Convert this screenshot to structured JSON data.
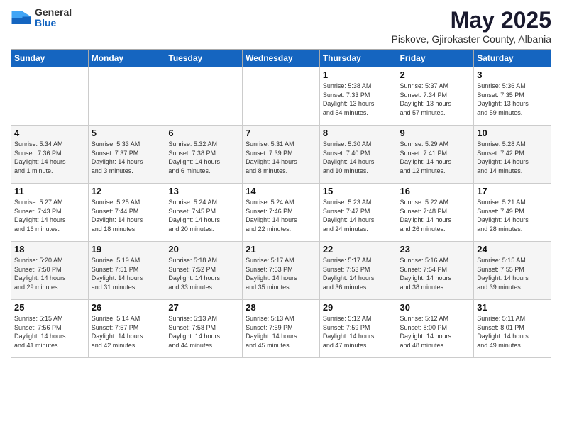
{
  "logo": {
    "general": "General",
    "blue": "Blue"
  },
  "title": "May 2025",
  "subtitle": "Piskove, Gjirokaster County, Albania",
  "headers": [
    "Sunday",
    "Monday",
    "Tuesday",
    "Wednesday",
    "Thursday",
    "Friday",
    "Saturday"
  ],
  "weeks": [
    [
      {
        "day": "",
        "info": ""
      },
      {
        "day": "",
        "info": ""
      },
      {
        "day": "",
        "info": ""
      },
      {
        "day": "",
        "info": ""
      },
      {
        "day": "1",
        "info": "Sunrise: 5:38 AM\nSunset: 7:33 PM\nDaylight: 13 hours\nand 54 minutes."
      },
      {
        "day": "2",
        "info": "Sunrise: 5:37 AM\nSunset: 7:34 PM\nDaylight: 13 hours\nand 57 minutes."
      },
      {
        "day": "3",
        "info": "Sunrise: 5:36 AM\nSunset: 7:35 PM\nDaylight: 13 hours\nand 59 minutes."
      }
    ],
    [
      {
        "day": "4",
        "info": "Sunrise: 5:34 AM\nSunset: 7:36 PM\nDaylight: 14 hours\nand 1 minute."
      },
      {
        "day": "5",
        "info": "Sunrise: 5:33 AM\nSunset: 7:37 PM\nDaylight: 14 hours\nand 3 minutes."
      },
      {
        "day": "6",
        "info": "Sunrise: 5:32 AM\nSunset: 7:38 PM\nDaylight: 14 hours\nand 6 minutes."
      },
      {
        "day": "7",
        "info": "Sunrise: 5:31 AM\nSunset: 7:39 PM\nDaylight: 14 hours\nand 8 minutes."
      },
      {
        "day": "8",
        "info": "Sunrise: 5:30 AM\nSunset: 7:40 PM\nDaylight: 14 hours\nand 10 minutes."
      },
      {
        "day": "9",
        "info": "Sunrise: 5:29 AM\nSunset: 7:41 PM\nDaylight: 14 hours\nand 12 minutes."
      },
      {
        "day": "10",
        "info": "Sunrise: 5:28 AM\nSunset: 7:42 PM\nDaylight: 14 hours\nand 14 minutes."
      }
    ],
    [
      {
        "day": "11",
        "info": "Sunrise: 5:27 AM\nSunset: 7:43 PM\nDaylight: 14 hours\nand 16 minutes."
      },
      {
        "day": "12",
        "info": "Sunrise: 5:25 AM\nSunset: 7:44 PM\nDaylight: 14 hours\nand 18 minutes."
      },
      {
        "day": "13",
        "info": "Sunrise: 5:24 AM\nSunset: 7:45 PM\nDaylight: 14 hours\nand 20 minutes."
      },
      {
        "day": "14",
        "info": "Sunrise: 5:24 AM\nSunset: 7:46 PM\nDaylight: 14 hours\nand 22 minutes."
      },
      {
        "day": "15",
        "info": "Sunrise: 5:23 AM\nSunset: 7:47 PM\nDaylight: 14 hours\nand 24 minutes."
      },
      {
        "day": "16",
        "info": "Sunrise: 5:22 AM\nSunset: 7:48 PM\nDaylight: 14 hours\nand 26 minutes."
      },
      {
        "day": "17",
        "info": "Sunrise: 5:21 AM\nSunset: 7:49 PM\nDaylight: 14 hours\nand 28 minutes."
      }
    ],
    [
      {
        "day": "18",
        "info": "Sunrise: 5:20 AM\nSunset: 7:50 PM\nDaylight: 14 hours\nand 29 minutes."
      },
      {
        "day": "19",
        "info": "Sunrise: 5:19 AM\nSunset: 7:51 PM\nDaylight: 14 hours\nand 31 minutes."
      },
      {
        "day": "20",
        "info": "Sunrise: 5:18 AM\nSunset: 7:52 PM\nDaylight: 14 hours\nand 33 minutes."
      },
      {
        "day": "21",
        "info": "Sunrise: 5:17 AM\nSunset: 7:53 PM\nDaylight: 14 hours\nand 35 minutes."
      },
      {
        "day": "22",
        "info": "Sunrise: 5:17 AM\nSunset: 7:53 PM\nDaylight: 14 hours\nand 36 minutes."
      },
      {
        "day": "23",
        "info": "Sunrise: 5:16 AM\nSunset: 7:54 PM\nDaylight: 14 hours\nand 38 minutes."
      },
      {
        "day": "24",
        "info": "Sunrise: 5:15 AM\nSunset: 7:55 PM\nDaylight: 14 hours\nand 39 minutes."
      }
    ],
    [
      {
        "day": "25",
        "info": "Sunrise: 5:15 AM\nSunset: 7:56 PM\nDaylight: 14 hours\nand 41 minutes."
      },
      {
        "day": "26",
        "info": "Sunrise: 5:14 AM\nSunset: 7:57 PM\nDaylight: 14 hours\nand 42 minutes."
      },
      {
        "day": "27",
        "info": "Sunrise: 5:13 AM\nSunset: 7:58 PM\nDaylight: 14 hours\nand 44 minutes."
      },
      {
        "day": "28",
        "info": "Sunrise: 5:13 AM\nSunset: 7:59 PM\nDaylight: 14 hours\nand 45 minutes."
      },
      {
        "day": "29",
        "info": "Sunrise: 5:12 AM\nSunset: 7:59 PM\nDaylight: 14 hours\nand 47 minutes."
      },
      {
        "day": "30",
        "info": "Sunrise: 5:12 AM\nSunset: 8:00 PM\nDaylight: 14 hours\nand 48 minutes."
      },
      {
        "day": "31",
        "info": "Sunrise: 5:11 AM\nSunset: 8:01 PM\nDaylight: 14 hours\nand 49 minutes."
      }
    ]
  ]
}
